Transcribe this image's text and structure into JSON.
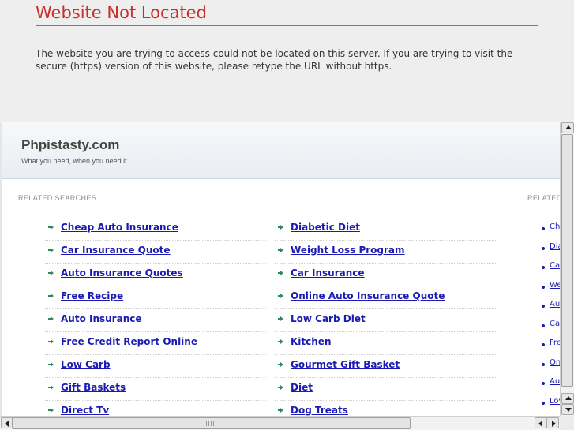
{
  "error": {
    "title": "Website Not Located",
    "message": "The website you are trying to access could not be located on this server. If you are trying to visit the secure (https) version of this website, please retype the URL without https."
  },
  "site": {
    "title": "Phpistasty.com",
    "tagline": "What you need, when you need it"
  },
  "main": {
    "section_label": "RELATED SEARCHES",
    "left_links": [
      "Cheap Auto Insurance",
      "Car Insurance Quote",
      "Auto Insurance Quotes",
      "Free Recipe",
      "Auto Insurance",
      "Free Credit Report Online",
      "Low Carb",
      "Gift Baskets",
      "Direct Tv"
    ],
    "right_links": [
      "Diabetic Diet",
      "Weight Loss Program",
      "Car Insurance",
      "Online Auto Insurance Quote",
      "Low Carb Diet",
      "Kitchen",
      "Gourmet Gift Basket",
      "Diet",
      "Dog Treats"
    ]
  },
  "side": {
    "section_label": "RELATED",
    "links": [
      "Ch",
      "Dia",
      "Ca",
      "We",
      "Au",
      "Ca",
      "Fre",
      "On",
      "Au",
      "Lov"
    ]
  },
  "colors": {
    "error_red": "#c9302c",
    "link_blue": "#1b1bb3",
    "arrow_green": "#2e8b57",
    "panel_grey": "#eeeeee"
  }
}
